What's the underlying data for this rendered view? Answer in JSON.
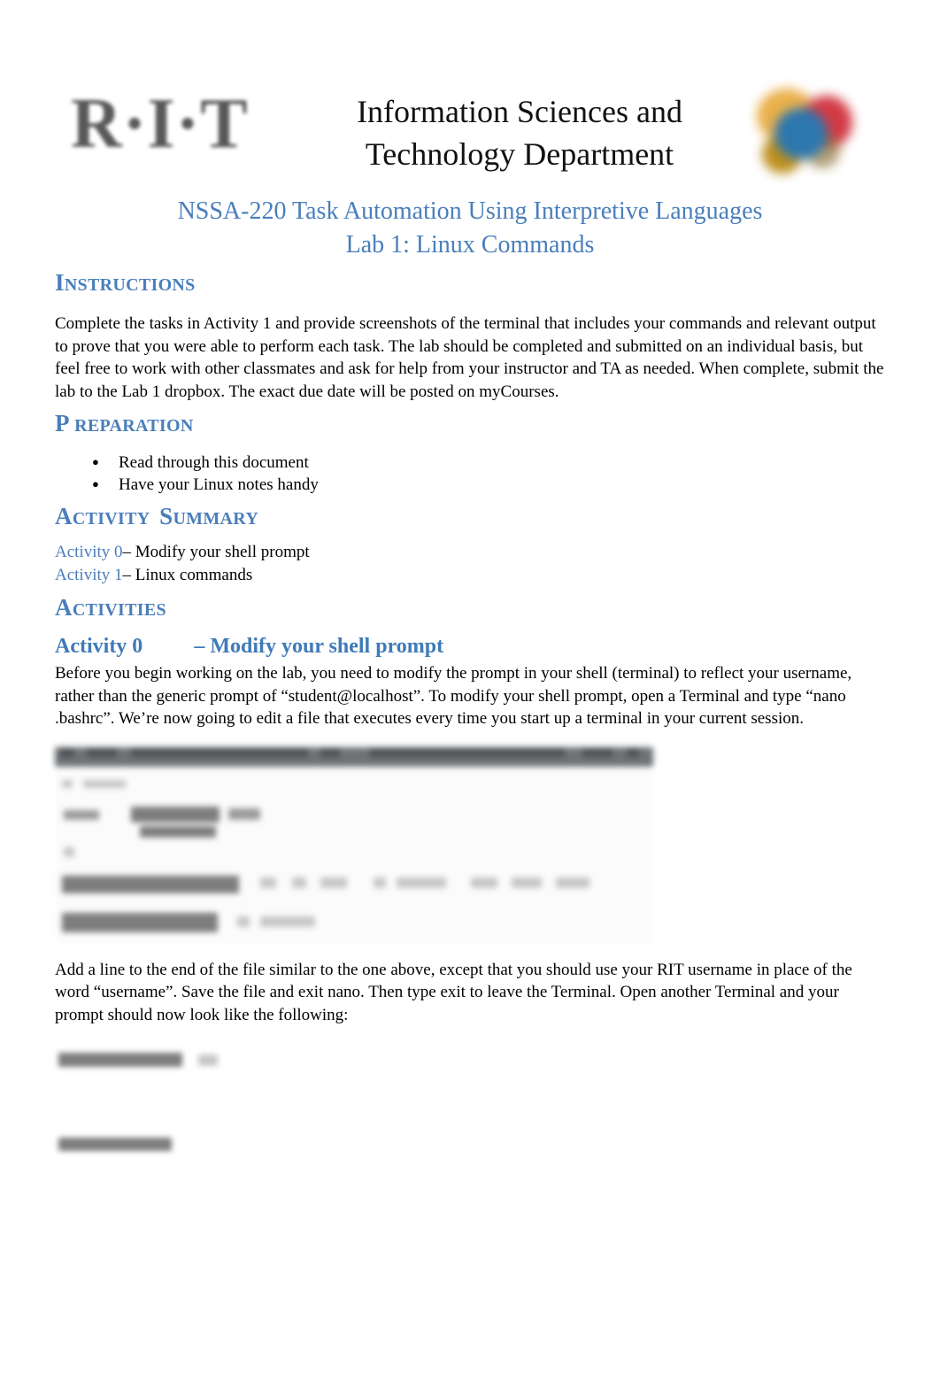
{
  "document": {
    "logo_text": "R·I·T",
    "department_title_line1": "Information Sciences and",
    "department_title_line2": "Technology Department",
    "course_line": "NSSA-220 Task Automation Using Interpretive Languages",
    "lab_line": "Lab 1:  Linux Commands"
  },
  "instructions": {
    "heading_cap": "I",
    "heading_rest": "NSTRUCTIONS",
    "body": "Complete the tasks in Activity 1 and provide screenshots of the terminal that includes your commands and relevant output to prove that you were able to perform each task. The lab should be completed and submitted on an individual basis, but feel free to work with other classmates and ask for help from your instructor and TA as needed. When complete, submit the lab to the Lab 1 dropbox. The exact due date will be posted on myCourses."
  },
  "preparation": {
    "heading_cap": "P",
    "heading_rest": " REPARATION",
    "items": [
      "Read through this document",
      "Have your Linux notes handy"
    ]
  },
  "activity_summary": {
    "heading_cap": "A",
    "heading_rest": "CTIVITY",
    "heading_cap2": "S",
    "heading_rest2": "UMMARY",
    "rows": [
      {
        "link": "Activity 0",
        "text": "– Modify your shell prompt"
      },
      {
        "link": "Activity 1",
        "text": "– Linux commands"
      }
    ]
  },
  "activities": {
    "heading_cap": "A",
    "heading_rest": "CTIVITIES"
  },
  "activity0": {
    "heading_label": "Activity 0",
    "heading_dash": "– Modify your shell prompt",
    "paragraph": "Before you begin working on the lab, you need to modify the prompt in your shell (terminal) to reflect your username, rather than the generic prompt of “student@localhost”. To modify your shell prompt, open a Terminal and type “nano .bashrc”. We’re now going to edit a file that executes every time you start up a terminal in your current session.",
    "paragraph2": "Add a line to the end of the file similar to the one above, except that you should use your RIT username in place of the word “username”. Save the file and exit nano. Then type exit to leave the Terminal. Open another Terminal and your prompt should now look like the following:"
  },
  "colors": {
    "heading_blue": "#4a7ebb",
    "activity_blue": "#3f7ab8",
    "body_black": "#000000",
    "titlebar_gray": "#6f7376",
    "logo_gray": "#595959",
    "seal_orange": "#e8a93c",
    "seal_red": "#cf2a36",
    "seal_blue": "#1b6ca8",
    "seal_gold": "#b8860b"
  }
}
